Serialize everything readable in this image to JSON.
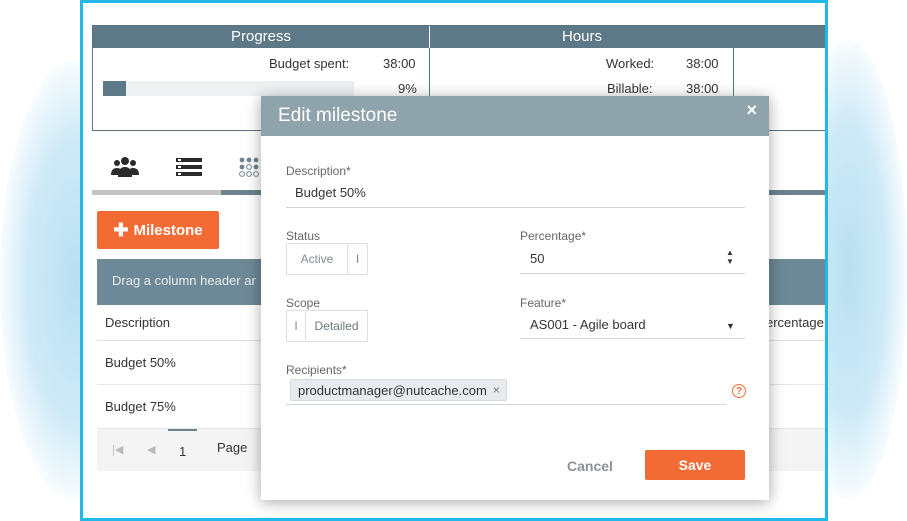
{
  "stats": {
    "progress_title": "Progress",
    "hours_title": "Hours",
    "budget_spent_label": "Budget spent:",
    "budget_spent_value": "38:00",
    "budget_percent": "9%",
    "budget_fraction": 0.09,
    "worked_label": "Worked:",
    "worked_value": "38:00",
    "billable_label": "Billable:",
    "billable_value": "38:00"
  },
  "tabs": {
    "icons": [
      "team-icon",
      "list-icon",
      "dots-grid-icon"
    ]
  },
  "toolbar": {
    "milestone_label": "Milestone"
  },
  "grid": {
    "group_hint": "Drag a column header ar",
    "columns": {
      "description": "Description",
      "percentage": "ercentage"
    },
    "rows": [
      {
        "description": "Budget 50%"
      },
      {
        "description": "Budget 75%"
      }
    ],
    "pager": {
      "page_number": "1",
      "page_label": "Page"
    }
  },
  "modal": {
    "title": "Edit milestone",
    "close_label": "×",
    "description_label": "Description*",
    "description_value": "Budget 50%",
    "status_label": "Status",
    "status_value": "Active",
    "status_other": "I",
    "percentage_label": "Percentage*",
    "percentage_value": "50",
    "scope_label": "Scope",
    "scope_other": "I",
    "scope_value": "Detailed",
    "feature_label": "Feature*",
    "feature_value": "AS001 - Agile board",
    "recipients_label": "Recipients*",
    "recipient_email": "productmanager@nutcache.com",
    "chip_remove": "×",
    "help": "?",
    "cancel_label": "Cancel",
    "save_label": "Save"
  },
  "colors": {
    "accent": "#f26b35",
    "header_slate": "#5d7886",
    "modal_header": "#8fa3ad",
    "frame_border": "#22b9e8"
  }
}
